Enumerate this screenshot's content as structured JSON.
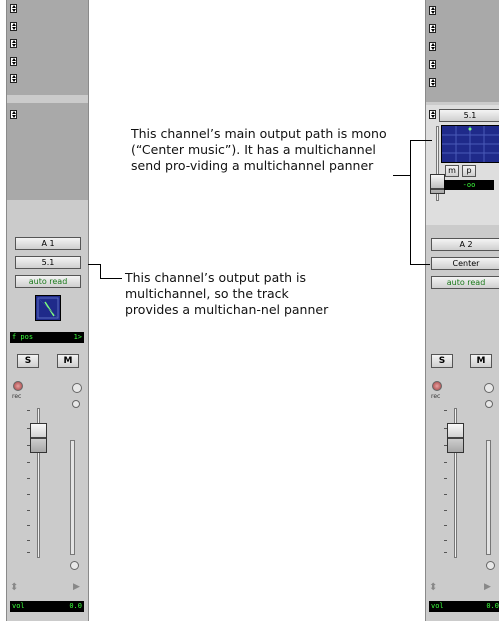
{
  "strip1": {
    "track_name": "A 1",
    "output_path": "5.1",
    "automation_mode": "auto read",
    "pan_readout_label": "f pos",
    "pan_readout_value": "1>",
    "solo": "S",
    "mute": "M",
    "record_label": "rec",
    "volume_label": "vol",
    "volume_value": "0.0"
  },
  "strip2": {
    "send_path": "5.1",
    "send_mute": "m",
    "send_pre": "p",
    "send_level": "-oo",
    "track_name": "A 2",
    "output_path": "Center",
    "automation_mode": "auto read",
    "solo": "S",
    "mute": "M",
    "record_label": "rec",
    "volume_label": "vol",
    "volume_value": "0.0"
  },
  "callouts": {
    "left_text": "This channel’s output path is multichannel, so the track provides a multichan-nel panner",
    "right_text": "This channel’s main output path is mono (“Center music”). It has a multichannel send pro-viding a multichannel panner"
  },
  "colors": {
    "strip_bg": "#cbcbcb",
    "insert_area": "#a9a9a9",
    "panner_bg": "#1f2a8a",
    "lcd_bg": "#000000",
    "lcd_text": "#3cff3c",
    "automation_text": "#1a7a1a"
  }
}
